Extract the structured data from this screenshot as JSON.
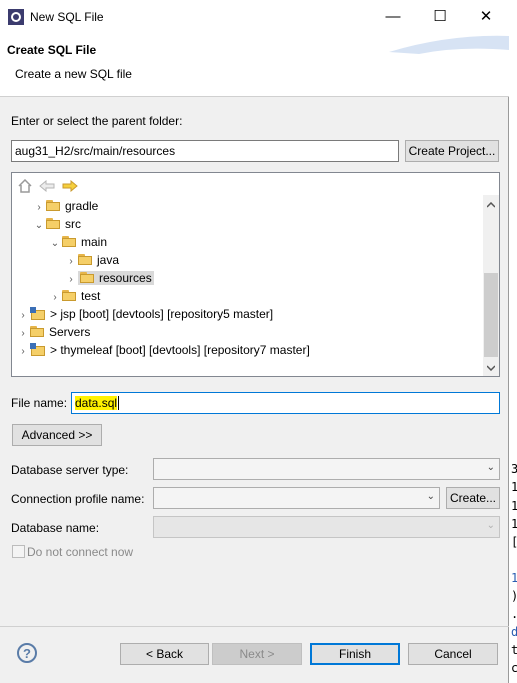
{
  "window": {
    "title": "New SQL File",
    "minimize": "—",
    "maximize": "☐",
    "close": "✕"
  },
  "banner": {
    "title": "Create SQL File",
    "description": "Create a new SQL file"
  },
  "parent_folder": {
    "label": "Enter or select the parent folder:",
    "value": "aug31_H2/src/main/resources",
    "create_project_button": "Create Project..."
  },
  "tree": {
    "nav_icons": [
      "home-icon",
      "back-arrow-icon",
      "forward-arrow-icon"
    ],
    "items": [
      {
        "label": "gradle",
        "toggle": "›",
        "icon": "folder"
      },
      {
        "label": "src",
        "toggle": "⌄",
        "icon": "folder"
      },
      {
        "label": "main",
        "toggle": "⌄",
        "icon": "folder"
      },
      {
        "label": "java",
        "toggle": "›",
        "icon": "folder"
      },
      {
        "label": "resources",
        "toggle": "›",
        "icon": "folder",
        "selected": true
      },
      {
        "label": "test",
        "toggle": "›",
        "icon": "folder"
      },
      {
        "label": "> jsp [boot] [devtools] [repository5 master]",
        "toggle": "›",
        "icon": "project"
      },
      {
        "label": "Servers",
        "toggle": "›",
        "icon": "folder"
      },
      {
        "label": "> thymeleaf [boot] [devtools] [repository7 master]",
        "toggle": "›",
        "icon": "project"
      }
    ]
  },
  "file_name": {
    "label": "File name:",
    "value": "data.sql"
  },
  "advanced_button": "Advanced >>",
  "db": {
    "server_type_label": "Database server type:",
    "server_type_value": "",
    "profile_label": "Connection profile name:",
    "profile_value": "",
    "profile_create_button": "Create...",
    "db_name_label": "Database name:",
    "db_name_value": "",
    "no_connect_label": "Do not connect now"
  },
  "footer": {
    "help": "?",
    "back": "< Back",
    "next": "Next >",
    "finish": "Finish",
    "cancel": "Cancel"
  },
  "background_text": [
    "3",
    "1",
    "1",
    "1",
    "[",
    "1",
    ")",
    ".",
    "d",
    "t",
    "c"
  ]
}
